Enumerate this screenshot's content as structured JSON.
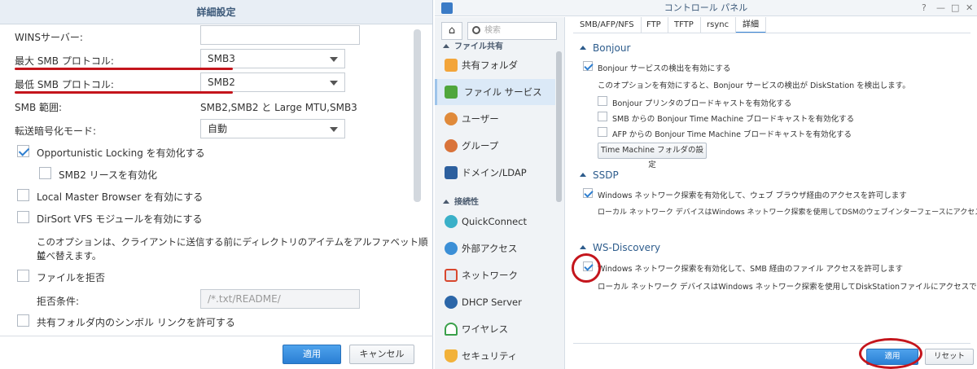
{
  "left": {
    "title": "詳細設定",
    "wins_label": "WINSサーバー:",
    "wins_value": "",
    "max_smb_label": "最大 SMB プロトコル:",
    "max_smb_value": "SMB3",
    "min_smb_label": "最低 SMB プロトコル:",
    "min_smb_value": "SMB2",
    "smb_range_label": "SMB 範囲:",
    "smb_range_value": "SMB2,SMB2 と Large MTU,SMB3",
    "transport_enc_label": "転送暗号化モード:",
    "transport_enc_value": "自動",
    "opportunistic_locking": "Opportunistic Locking を有効化する",
    "smb2_lease": "SMB2 リースを有効化",
    "local_master_browser": "Local Master Browser を有効にする",
    "dirsort_vfs": "DirSort VFS モジュールを有効にする",
    "dirsort_note_1": "このオプションは、クライアントに送信する前にディレクトリのアイテムをアルファベット順に",
    "dirsort_note_2": "並べ替えます。",
    "veto_files": "ファイルを拒否",
    "veto_rule_label": "拒否条件:",
    "veto_rule_placeholder": "/*.txt/README/",
    "symlink": "共有フォルダ内のシンボル リンクを許可する",
    "apply": "適用",
    "cancel": "キャンセル"
  },
  "right": {
    "window_title": "コントロール パネル",
    "window_buttons": [
      "?",
      "—",
      "□",
      "✕"
    ],
    "search_placeholder": "検索",
    "home_icon": "home-icon",
    "categories": {
      "file_sharing": "ファイル共有",
      "connectivity": "接続性"
    },
    "nav": [
      {
        "label": "共有フォルダ",
        "icon": "shared-folder-icon"
      },
      {
        "label": "ファイル サービス",
        "icon": "file-services-icon"
      },
      {
        "label": "ユーザー",
        "icon": "user-icon"
      },
      {
        "label": "グループ",
        "icon": "group-icon"
      },
      {
        "label": "ドメイン/LDAP",
        "icon": "domain-ldap-icon"
      },
      {
        "label": "QuickConnect",
        "icon": "quickconnect-icon"
      },
      {
        "label": "外部アクセス",
        "icon": "external-access-icon"
      },
      {
        "label": "ネットワーク",
        "icon": "network-icon"
      },
      {
        "label": "DHCP Server",
        "icon": "dhcp-server-icon"
      },
      {
        "label": "ワイヤレス",
        "icon": "wireless-icon"
      },
      {
        "label": "セキュリティ",
        "icon": "security-icon"
      }
    ],
    "tabs": [
      "SMB/AFP/NFS",
      "FTP",
      "TFTP",
      "rsync",
      "詳細"
    ],
    "bonjour": {
      "heading": "Bonjour",
      "enable": "Bonjour サービスの検出を有効にする",
      "note": "このオプションを有効にすると、Bonjour サービスの検出が DiskStation を検出します。",
      "printer": "Bonjour プリンタのブロードキャストを有効化する",
      "smb_tm": "SMB からの Bonjour Time Machine ブロードキャストを有効化する",
      "afp_tm": "AFP からの Bonjour Time Machine ブロードキャストを有効化する",
      "tm_button": "Time Machine フォルダの設定"
    },
    "ssdp": {
      "heading": "SSDP",
      "enable": "Windows ネットワーク探索を有効化して、ウェブ ブラウザ経由のアクセスを許可します",
      "note": "ローカル ネットワーク デバイスはWindows ネットワーク探索を使用してDSMのウェブインターフェースにアクセスできます。"
    },
    "wsd": {
      "heading": "WS-Discovery",
      "enable": "Windows ネットワーク探索を有効化して、SMB 経由のファイル アクセスを許可します",
      "note": "ローカル ネットワーク デバイスはWindows ネットワーク探索を使用してDiskStationファイルにアクセスできます。"
    },
    "apply": "適用",
    "reset": "リセット"
  },
  "colors": {
    "accent_blue": "#2a7fd4",
    "annotation_red": "#c4151c",
    "section_blue": "#2d5c8c"
  }
}
